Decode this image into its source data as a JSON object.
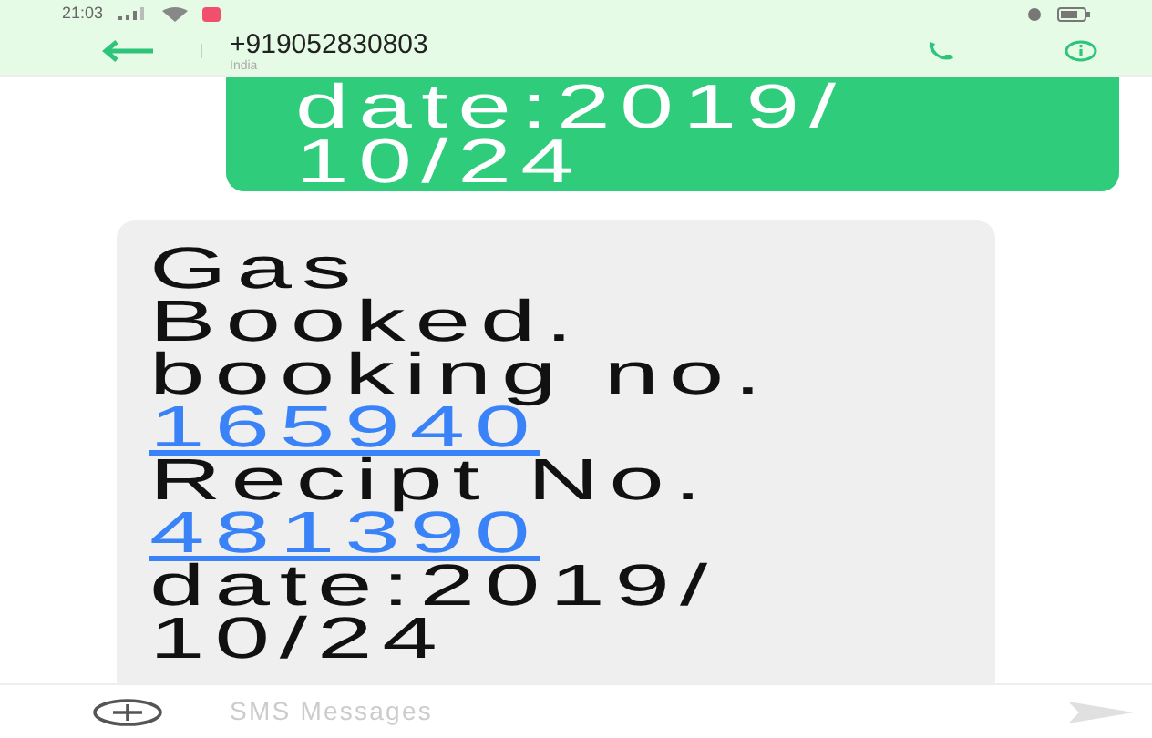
{
  "status_bar": {
    "time": "21:03"
  },
  "header": {
    "title": "+919052830803",
    "subtitle": "India"
  },
  "messages": [
    {
      "kind": "sent",
      "lines": [
        {
          "text": "date:2019/",
          "link": false
        },
        {
          "text": "10/24",
          "link": false
        }
      ]
    },
    {
      "kind": "received",
      "lines": [
        {
          "text": "Gas",
          "link": false
        },
        {
          "text": "Booked.",
          "link": false
        },
        {
          "text": "booking no.",
          "link": false
        },
        {
          "text": "165940",
          "link": true
        },
        {
          "text": "Recipt No.",
          "link": false
        },
        {
          "text": "481390",
          "link": true
        },
        {
          "text": "date:2019/",
          "link": false
        },
        {
          "text": "10/24",
          "link": false
        }
      ]
    }
  ],
  "composer": {
    "placeholder": "SMS Messages"
  }
}
